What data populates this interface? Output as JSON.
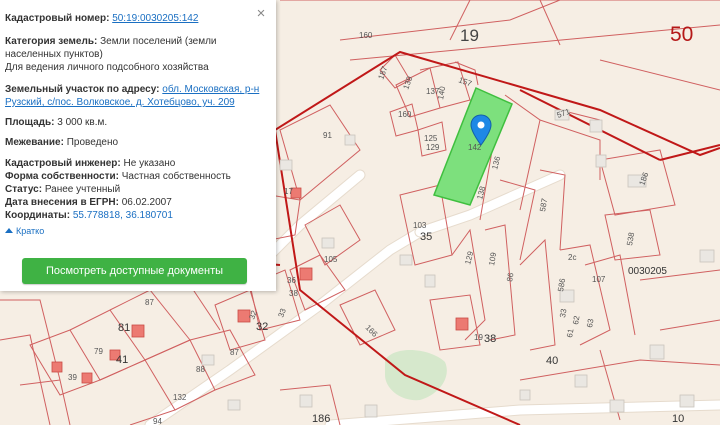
{
  "panel": {
    "cadastral_number_label": "Кадастровый номер:",
    "cadastral_number": "50:19:0030205:142",
    "land_category_label": "Категория земель:",
    "land_category_line1": "Земли поселений (земли",
    "land_category_line2": "населенных пунктов)",
    "land_use": "Для ведения личного подсобного хозяйства",
    "address_label": "Земельный участок по адресу:",
    "address_line1": "обл. Московская, р-н",
    "address_line2": "Рузский, с/пос. Волковское, д. Хотебцово, уч. 209",
    "area_label": "Площадь:",
    "area": "3 000 кв.м.",
    "survey_label": "Межевание:",
    "survey": "Проведено",
    "engineer_label": "Кадастровый инженер:",
    "engineer": "Не указано",
    "ownership_label": "Форма собственности:",
    "ownership": "Частная собственность",
    "status_label": "Статус:",
    "status": "Ранее учтенный",
    "egrn_date_label": "Дата внесения в ЕГРН:",
    "egrn_date": "06.02.2007",
    "coords_label": "Координаты:",
    "coords": "55.778818, 36.180701",
    "brief_label": "Кратко",
    "docs_button": "Посмотреть доступные документы",
    "close_symbol": "×"
  },
  "map": {
    "quarter_number": "19",
    "district_number": "50",
    "quarter_code": "0030205",
    "parcel_labels": [
      "160",
      "157",
      "187",
      "139",
      "137",
      "140",
      "160",
      "125",
      "129",
      "142",
      "138",
      "136",
      "571",
      "91",
      "17",
      "186",
      "103",
      "35",
      "587",
      "538",
      "105",
      "129",
      "109",
      "86",
      "107",
      "2c",
      "36",
      "38",
      "166",
      "586",
      "81",
      "87",
      "87",
      "32",
      "33",
      "32",
      "41",
      "88",
      "19",
      "38",
      "79",
      "40",
      "39",
      "33",
      "62",
      "63",
      "61",
      "132",
      "94",
      "186",
      "10"
    ]
  },
  "colors": {
    "block_boundary": "#c01818",
    "parcel_boundary": "#d06060",
    "selected_parcel": "#7de07d",
    "button": "#3fb244",
    "link": "#1a6fc2"
  },
  "icons": {
    "marker": "map-pin-icon",
    "close": "close-icon",
    "collapse": "chevron-up-icon"
  }
}
